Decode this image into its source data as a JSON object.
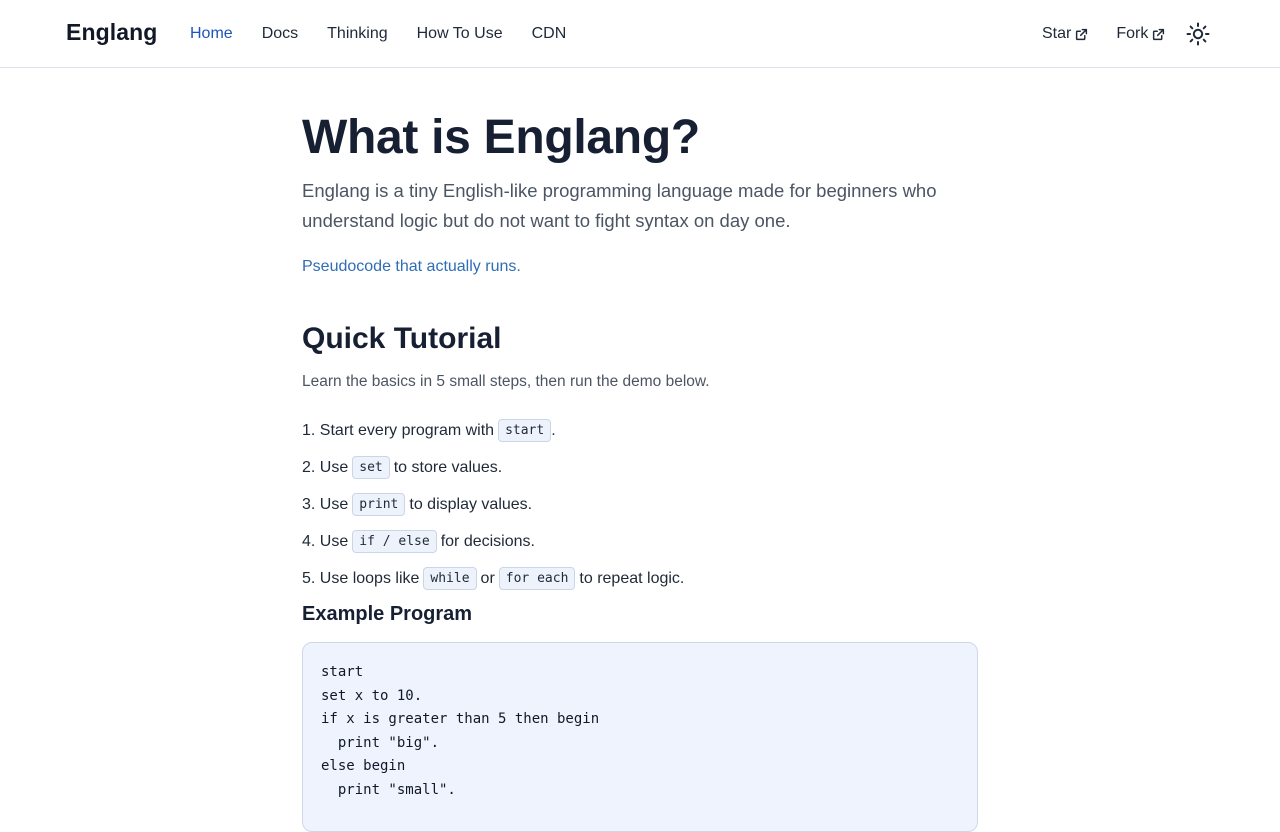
{
  "brand": "Englang",
  "nav": {
    "links": [
      {
        "label": "Home",
        "active": true
      },
      {
        "label": "Docs",
        "active": false
      },
      {
        "label": "Thinking",
        "active": false
      },
      {
        "label": "How To Use",
        "active": false
      },
      {
        "label": "CDN",
        "active": false
      }
    ],
    "star_label": "Star",
    "fork_label": "Fork",
    "theme_icon": "sun-icon"
  },
  "hero": {
    "title": "What is Englang?",
    "lead": "Englang is a tiny English-like programming language made for beginners who understand logic but do not want to fight syntax on day one.",
    "tagline": "Pseudocode that actually runs."
  },
  "tutorial": {
    "title": "Quick Tutorial",
    "intro": "Learn the basics in 5 small steps, then run the demo below.",
    "steps": [
      {
        "n": "1.",
        "pre": "Start every program with",
        "code": [
          "start"
        ],
        "between": "",
        "post": "."
      },
      {
        "n": "2.",
        "pre": "Use",
        "code": [
          "set"
        ],
        "between": "",
        "post": "to store values."
      },
      {
        "n": "3.",
        "pre": "Use",
        "code": [
          "print"
        ],
        "between": "",
        "post": "to display values."
      },
      {
        "n": "4.",
        "pre": "Use",
        "code": [
          "if / else"
        ],
        "between": "",
        "post": "for decisions."
      },
      {
        "n": "5.",
        "pre": "Use loops like",
        "code": [
          "while",
          "for each"
        ],
        "between": "or",
        "post": "to repeat logic."
      }
    ]
  },
  "example": {
    "title": "Example Program",
    "lines": [
      "start",
      "set x to 10.",
      "if x is greater than 5 then begin",
      "  print \"big\".",
      "else begin",
      "  print \"small\"."
    ]
  },
  "colors": {
    "accent": "#1e54b7",
    "tagline": "#2f6db5",
    "code_bg": "#eef3fd"
  }
}
